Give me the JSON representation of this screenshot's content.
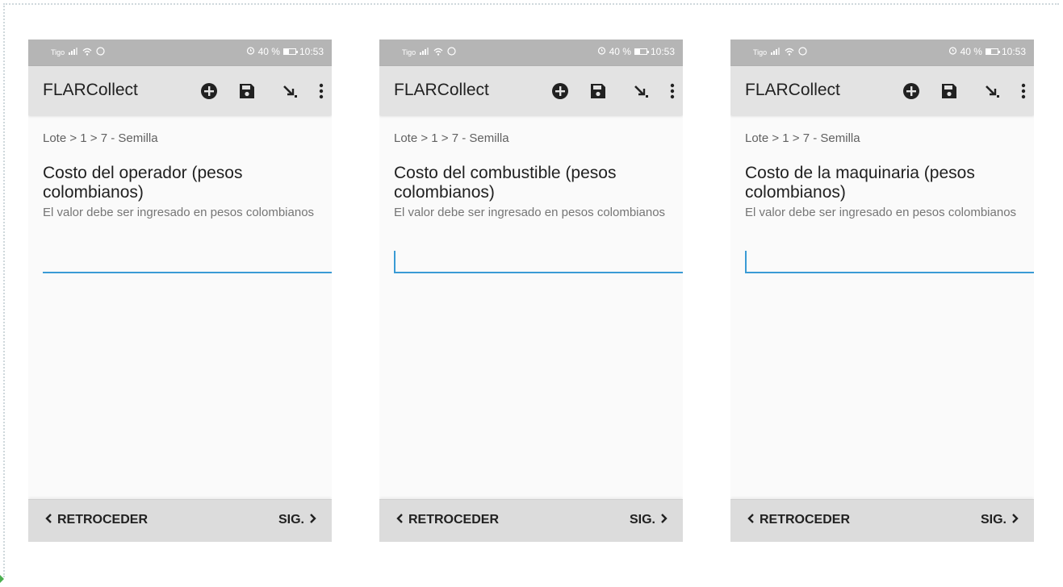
{
  "screens": [
    {
      "status_bar": {
        "carrier": "Tigo",
        "battery": "40 %",
        "time": "10:53"
      },
      "toolbar": {
        "title": "FLARCollect",
        "icons": [
          "add-circle-icon",
          "save-icon",
          "jump-icon",
          "more-vert-icon"
        ]
      },
      "breadcrumb": "Lote > 1 > 7 - Semilla",
      "question": "Costo del operador (pesos colombianos)",
      "hint": "El valor debe ser ingresado en pesos colombianos",
      "answer_value": "",
      "focused": false,
      "nav": {
        "back": "RETROCEDER",
        "next": "SIG."
      }
    },
    {
      "status_bar": {
        "carrier": "Tigo",
        "battery": "40 %",
        "time": "10:53"
      },
      "toolbar": {
        "title": "FLARCollect",
        "icons": [
          "add-circle-icon",
          "save-icon",
          "jump-icon",
          "more-vert-icon"
        ]
      },
      "breadcrumb": "Lote > 1 > 7 - Semilla",
      "question": "Costo del combustible (pesos colombianos)",
      "hint": "El valor debe ser ingresado en pesos colombianos",
      "answer_value": "",
      "focused": true,
      "nav": {
        "back": "RETROCEDER",
        "next": "SIG."
      }
    },
    {
      "status_bar": {
        "carrier": "Tigo",
        "battery": "40 %",
        "time": "10:53"
      },
      "toolbar": {
        "title": "FLARCollect",
        "icons": [
          "add-circle-icon",
          "save-icon",
          "jump-icon",
          "more-vert-icon"
        ]
      },
      "breadcrumb": "Lote > 1 > 7 - Semilla",
      "question": "Costo de la maquinaria (pesos colombianos)",
      "hint": "El valor debe ser ingresado en pesos colombianos",
      "answer_value": "",
      "focused": true,
      "nav": {
        "back": "RETROCEDER",
        "next": "SIG."
      }
    }
  ],
  "colors": {
    "status_bar": "#b5b5b5",
    "toolbar": "#e3e3e3",
    "accent": "#3a9bd5",
    "bottom_bar": "#dcdcdc"
  }
}
